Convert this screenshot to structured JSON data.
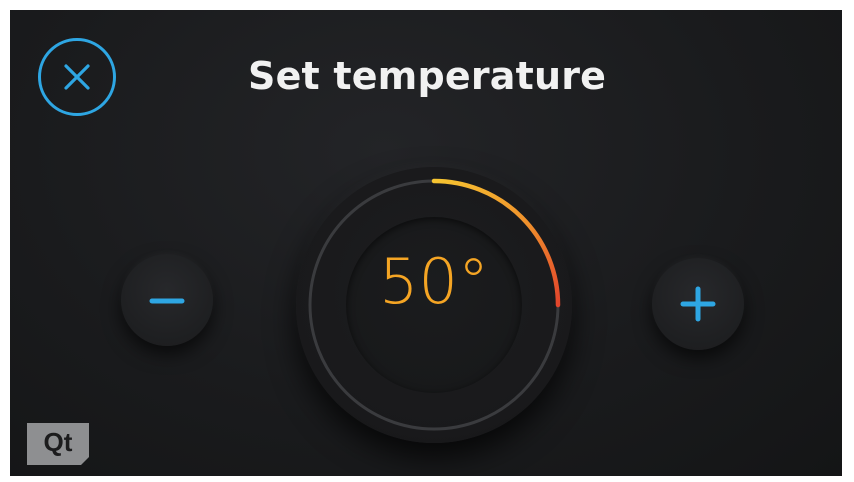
{
  "header": {
    "title": "Set temperature",
    "close_icon": "close-icon"
  },
  "controls": {
    "decrease_icon": "minus-icon",
    "increase_icon": "plus-icon"
  },
  "dial": {
    "value": 50,
    "value_text": "50°",
    "unit": "°",
    "arc_fraction": 0.25
  },
  "branding": {
    "logo_text": "Qt"
  },
  "colors": {
    "accent_blue": "#2ea6e3",
    "value_orange": "#f5a524",
    "arc_start_yellow": "#f6c531",
    "arc_end_red": "#e2452c",
    "background": "#1a1b1d",
    "title": "#f1f1f1"
  }
}
